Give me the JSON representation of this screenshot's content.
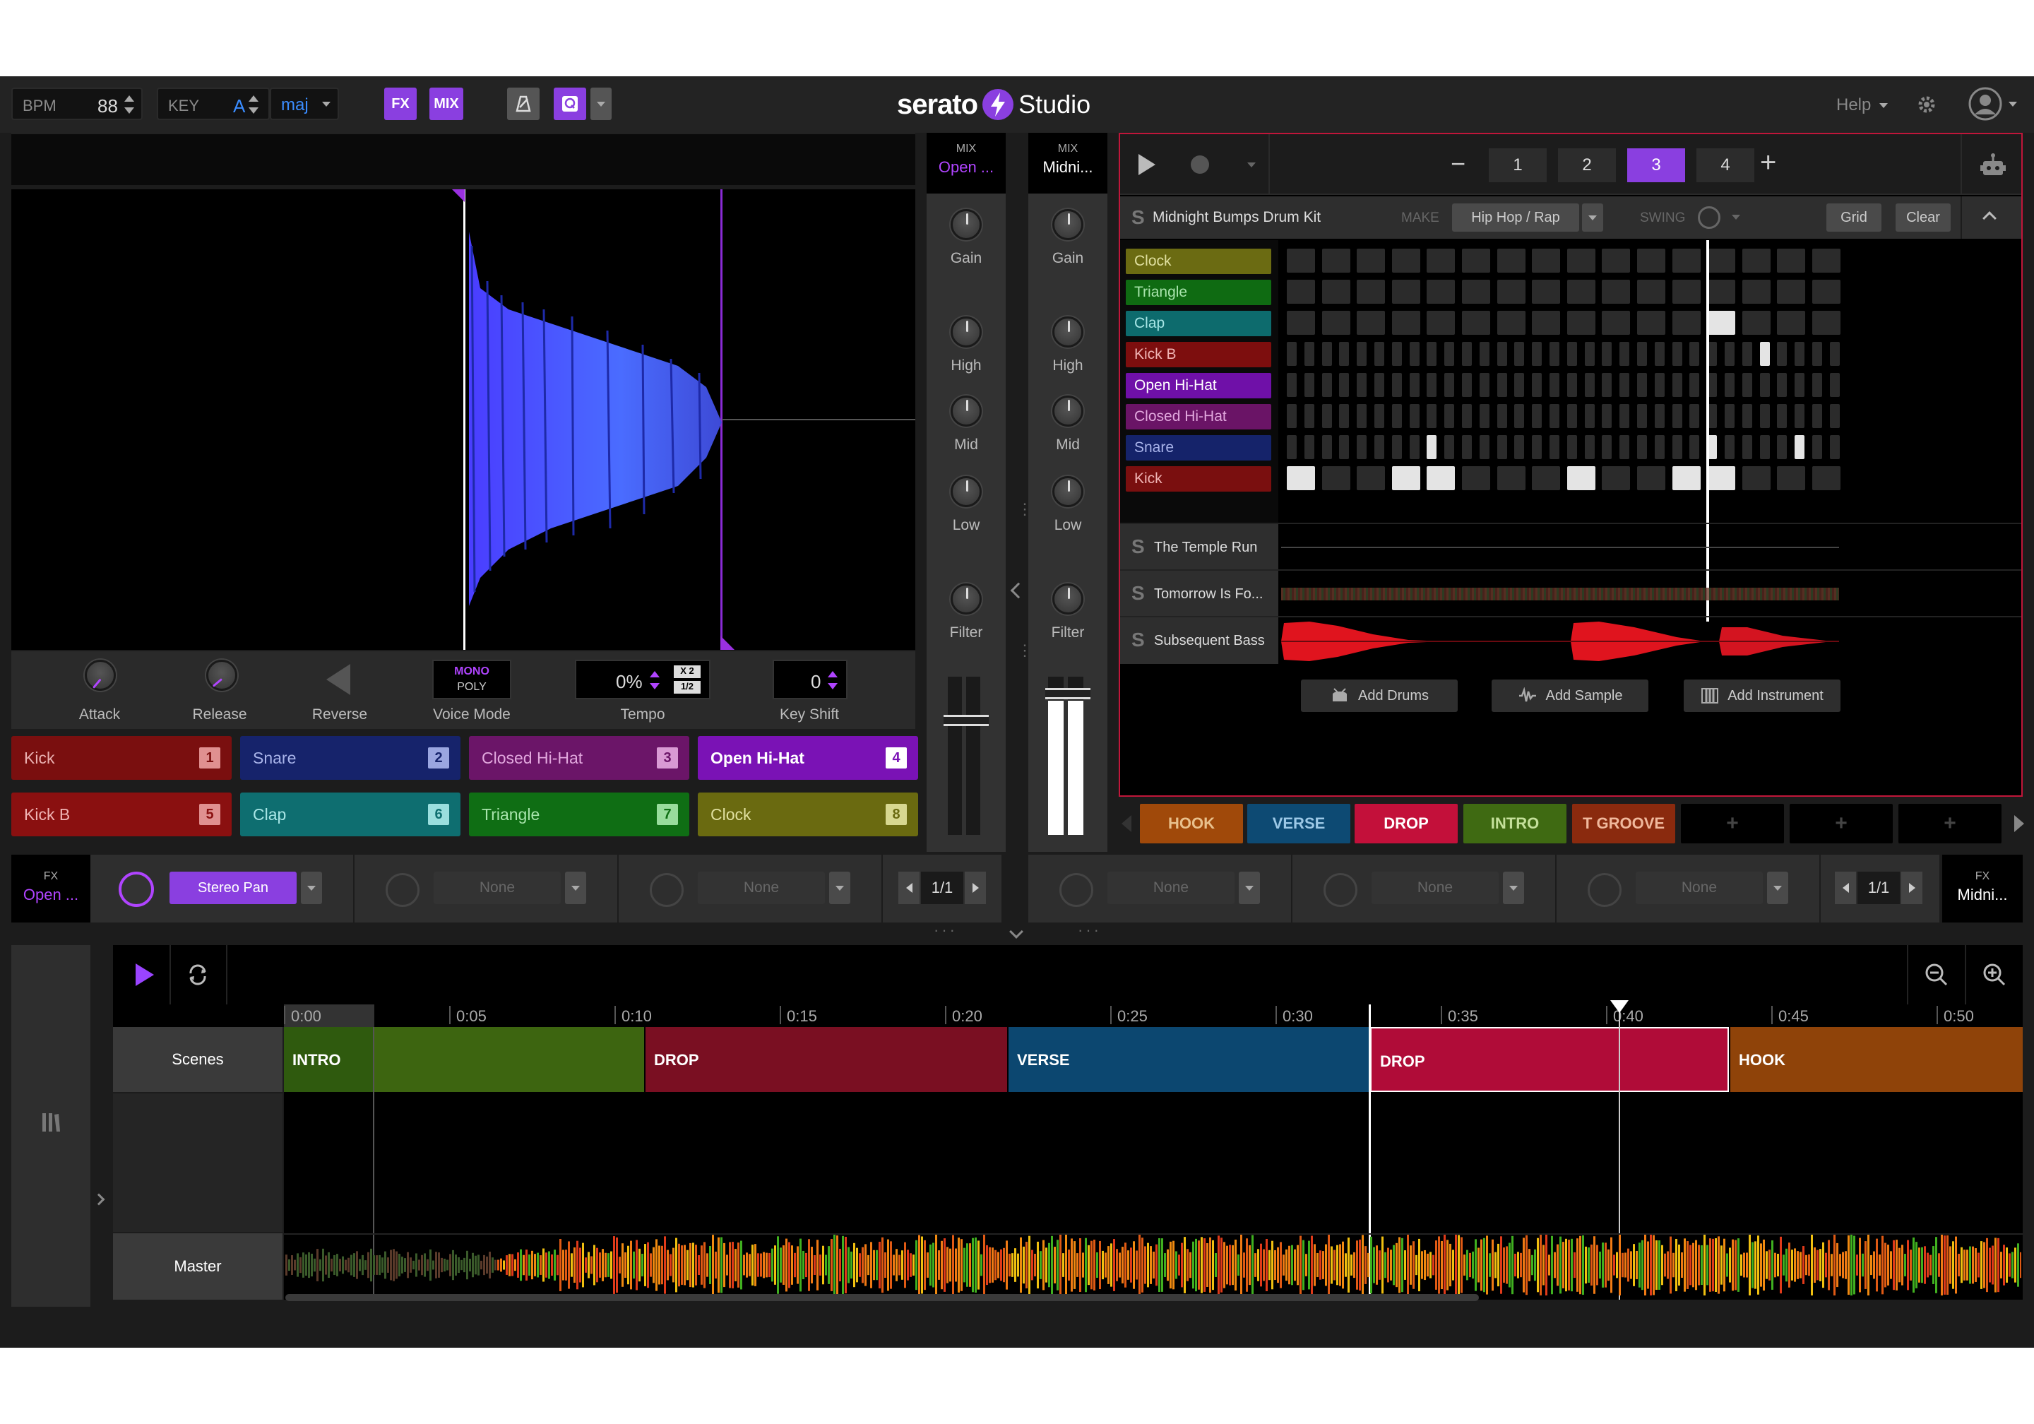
{
  "topbar": {
    "bpm_label": "BPM",
    "bpm_value": "88",
    "key_label": "KEY",
    "key_value": "A",
    "key_mode": "maj",
    "fx_label": "FX",
    "mix_label": "MIX",
    "logo_text": "serato",
    "logo_studio": "Studio",
    "help_label": "Help"
  },
  "left_deck": {
    "controls": [
      {
        "label": "Attack"
      },
      {
        "label": "Release"
      },
      {
        "label": "Reverse"
      },
      {
        "label": "Voice Mode"
      },
      {
        "label": "Tempo"
      },
      {
        "label": "Key Shift"
      }
    ],
    "voice_mode_top": "MONO",
    "voice_mode_bottom": "POLY",
    "tempo_value": "0%",
    "tempo_x2": "X 2",
    "tempo_half": "1/2",
    "keyshift_value": "0",
    "pads": [
      {
        "label": "Kick",
        "num": "1",
        "color": "#7a0f0f"
      },
      {
        "label": "Snare",
        "num": "2",
        "color": "#16236b"
      },
      {
        "label": "Closed Hi-Hat",
        "num": "3",
        "color": "#6b1568"
      },
      {
        "label": "Open Hi-Hat",
        "num": "4",
        "color": "#7a12b5"
      },
      {
        "label": "Kick B",
        "num": "5",
        "color": "#8a1010"
      },
      {
        "label": "Clap",
        "num": "6",
        "color": "#0e6e70"
      },
      {
        "label": "Triangle",
        "num": "7",
        "color": "#0f6e14"
      },
      {
        "label": "Clock",
        "num": "8",
        "color": "#6a6a10"
      }
    ]
  },
  "mixer": {
    "left": {
      "mix_label": "MIX",
      "name": "Open ...",
      "knobs": [
        "Gain",
        "High",
        "Mid",
        "Low",
        "Filter"
      ]
    },
    "right": {
      "mix_label": "MIX",
      "name": "Midni...",
      "knobs": [
        "Gain",
        "High",
        "Mid",
        "Low",
        "Filter"
      ]
    }
  },
  "sequencer": {
    "patterns": [
      "1",
      "2",
      "3",
      "4"
    ],
    "active_pattern": "3",
    "kit_name": "Midnight Bumps Drum Kit",
    "make_label": "MAKE",
    "genre": "Hip Hop / Rap",
    "swing_label": "SWING",
    "grid_label": "Grid",
    "clear_label": "Clear",
    "rows": [
      {
        "label": "Clock",
        "color": "#6b6b12"
      },
      {
        "label": "Triangle",
        "color": "#0f6b12"
      },
      {
        "label": "Clap",
        "color": "#0d6b6d"
      },
      {
        "label": "Kick B",
        "color": "#7d0e0e"
      },
      {
        "label": "Open Hi-Hat",
        "color": "#6f10a8"
      },
      {
        "label": "Closed Hi-Hat",
        "color": "#6a1466"
      },
      {
        "label": "Snare",
        "color": "#15236a"
      },
      {
        "label": "Kick",
        "color": "#7a0f0f"
      }
    ],
    "tracks": [
      "The Temple Run",
      "Tomorrow Is Fo...",
      "Subsequent Bass"
    ],
    "add_drums": "Add Drums",
    "add_sample": "Add Sample",
    "add_instrument": "Add Instrument",
    "scenes": [
      {
        "label": "HOOK",
        "color": "#a0490a"
      },
      {
        "label": "VERSE",
        "color": "#0d4a73"
      },
      {
        "label": "DROP",
        "color": "#c3103a"
      },
      {
        "label": "INTRO",
        "color": "#3f6a12"
      },
      {
        "label": "T GROOVE",
        "color": "#8a2a0e"
      },
      {
        "label": "+",
        "color": "#000000"
      },
      {
        "label": "+",
        "color": "#000000"
      },
      {
        "label": "+",
        "color": "#000000"
      }
    ]
  },
  "fx": {
    "left": {
      "fx_label": "FX",
      "name": "Open ...",
      "slot1": "Stereo Pan",
      "slot2": "None",
      "slot3": "None",
      "page": "1/1"
    },
    "right": {
      "fx_label": "FX",
      "name": "Midni...",
      "slot1": "None",
      "slot2": "None",
      "slot3": "None",
      "page": "1/1"
    }
  },
  "timeline": {
    "ticks": [
      "0:00",
      "0:05",
      "0:10",
      "0:15",
      "0:20",
      "0:25",
      "0:30",
      "0:35",
      "0:40",
      "0:45",
      "0:50"
    ],
    "scenes_label": "Scenes",
    "master_label": "Master",
    "segments": [
      {
        "label": "INTRO",
        "color": "#2f5a0e"
      },
      {
        "label": "",
        "color": "#3d6510"
      },
      {
        "label": "DROP",
        "color": "#7a0f22"
      },
      {
        "label": "VERSE",
        "color": "#0c4770"
      },
      {
        "label": "DROP",
        "color": "#b00c38"
      },
      {
        "label": "HOOK",
        "color": "#8f4309"
      }
    ]
  }
}
